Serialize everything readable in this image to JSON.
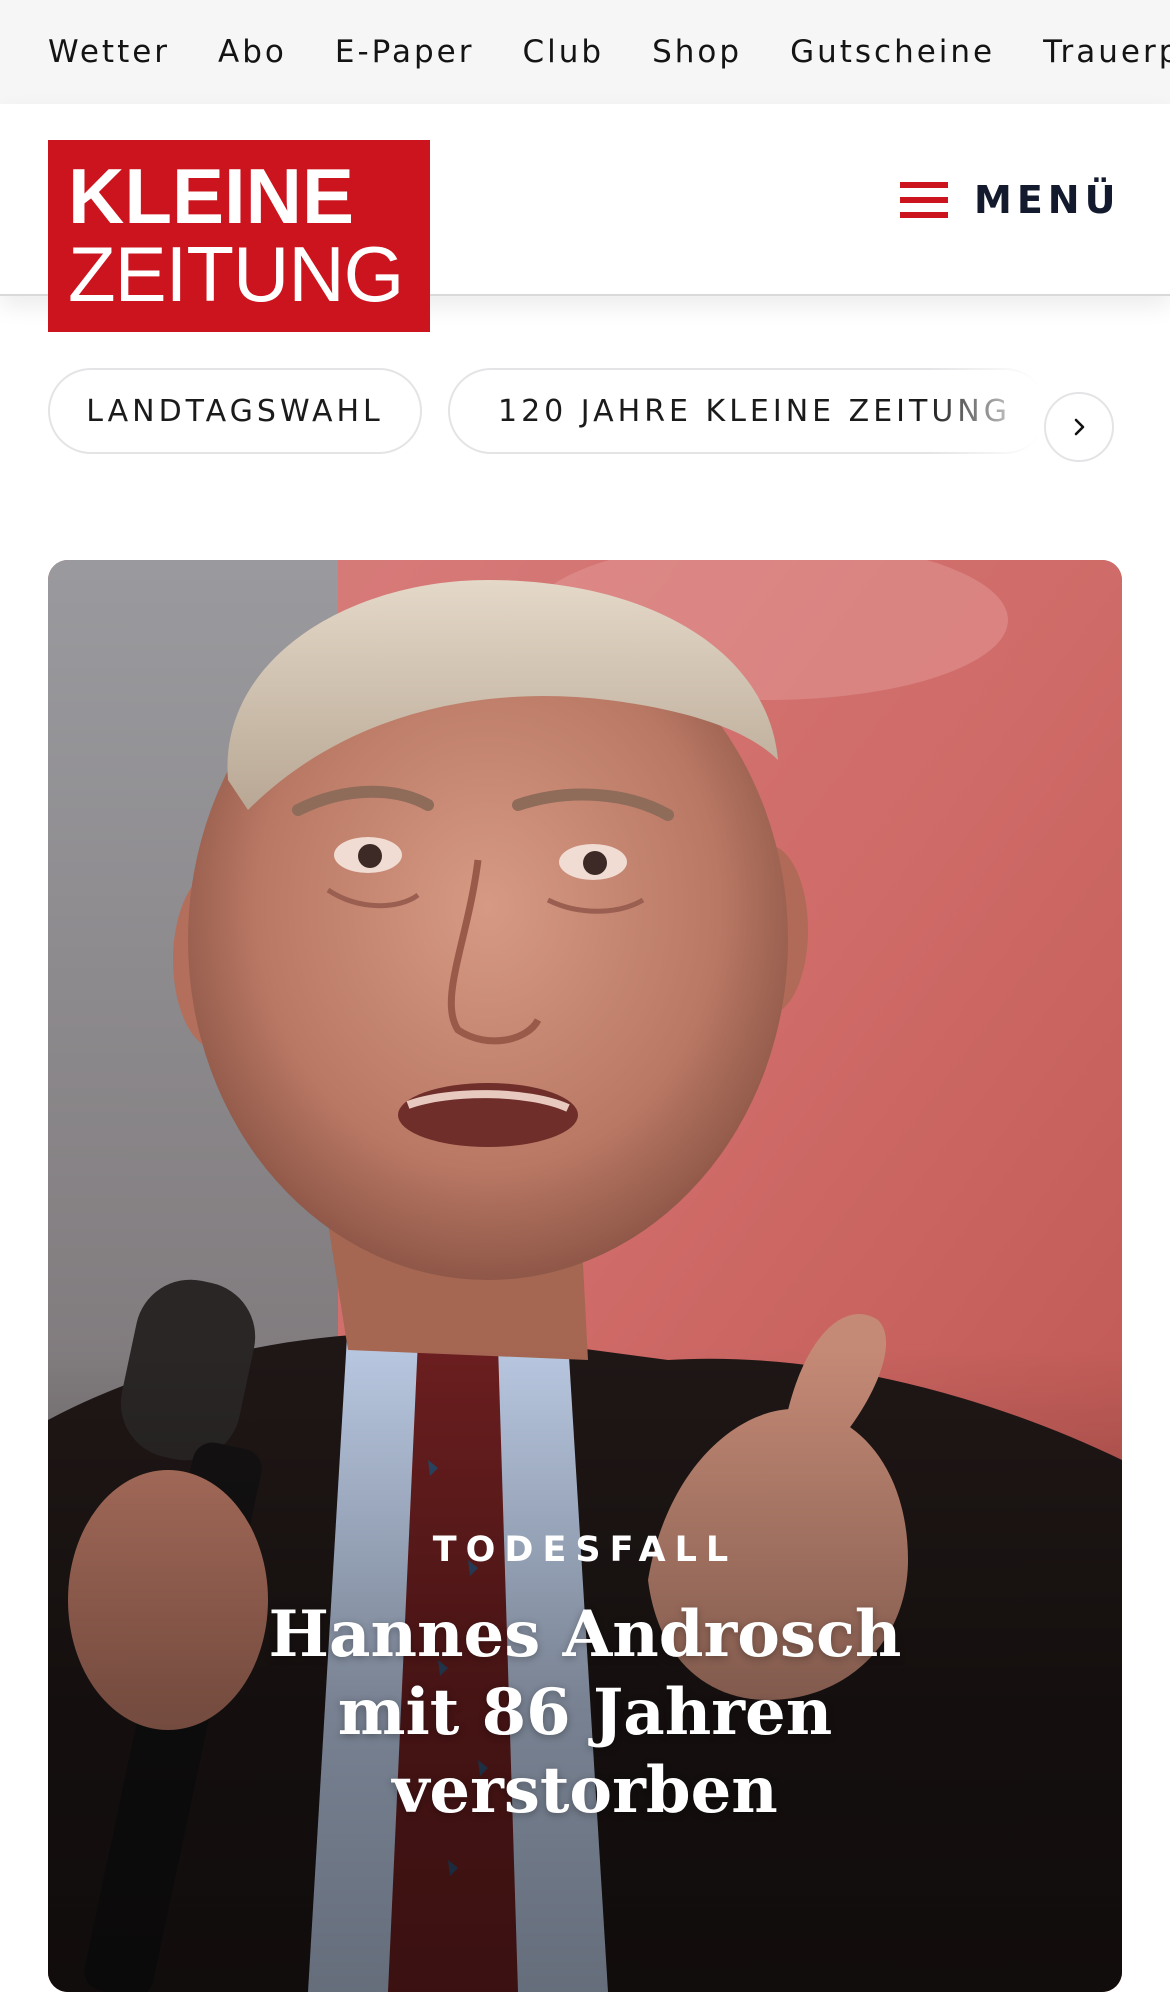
{
  "topbar": {
    "links": [
      "Wetter",
      "Abo",
      "E-Paper",
      "Club",
      "Shop",
      "Gutscheine",
      "Trauerportal"
    ]
  },
  "header": {
    "logo_line1": "KLEINE",
    "logo_line2": "ZEITUNG",
    "menu_label": "MENÜ",
    "icons": {
      "menu": "hamburger-icon",
      "chips_next": "chevron-right-icon"
    }
  },
  "topics": {
    "chips": [
      "LANDTAGSWAHL",
      "120 JAHRE KLEINE ZEITUNG"
    ]
  },
  "hero": {
    "kicker": "TODESFALL",
    "title": "Hannes Androsch mit 86 Jahren verstorben"
  },
  "colors": {
    "brand_red": "#cc141e",
    "topbar_bg": "#f6f6f7",
    "menu_text": "#141a2e"
  }
}
